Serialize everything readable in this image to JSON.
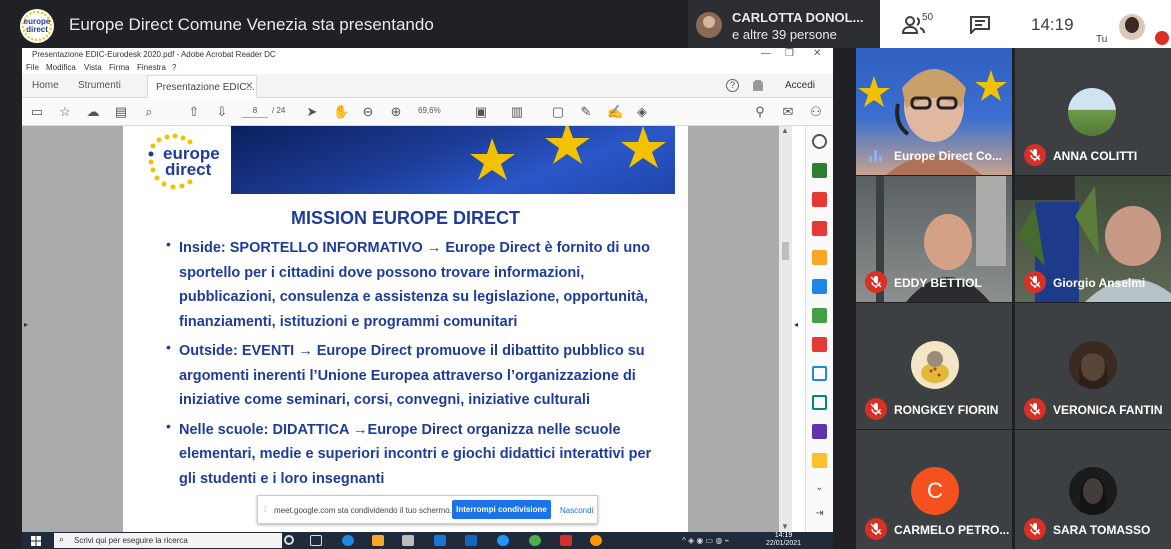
{
  "meet": {
    "title": "Europe Direct Comune Venezia sta presentando",
    "logo_line1": "europe",
    "logo_line2": "direct",
    "presenter_name": "CARLOTTA DONOL...",
    "presenter_sub": "e altre 39 persone",
    "people_count": "50",
    "time": "14:19",
    "self_label": "Tu"
  },
  "acrobat": {
    "window_title": "Presentazione EDIC-Eurodesk 2020.pdf - Adobe Acrobat Reader DC",
    "menu": [
      "File",
      "Modifica",
      "Vista",
      "Firma",
      "Finestra",
      "?"
    ],
    "tabs": [
      "Home",
      "Strumenti"
    ],
    "active_tab": "Presentazione EDIC...",
    "signin": "Accedi",
    "page_current": "8",
    "page_total": "/ 24",
    "zoom": "69,6%"
  },
  "document": {
    "logo_line1": "europe",
    "logo_line2": "direct",
    "heading": "MISSION EUROPE DIRECT",
    "bullets": [
      "Inside:  SPORTELLO INFORMATIVO → Europe Direct è fornito di uno sportello per i cittadini  dove possono trovare informazioni, pubblicazioni, consulenza e assistenza su legislazione, opportunità, finanziamenti, istituzioni e programmi comunitari",
      "Outside: EVENTI → Europe Direct promuove il dibattito pubblico su argomenti inerenti l’Unione Europea attraverso l’organizzazione di iniziative come seminari, corsi, convegni, iniziative culturali",
      "Nelle scuole: DIDATTICA  →Europe Direct organizza nelle scuole elementari, medie e superiori incontri e giochi didattici interattivi per gli studenti e i loro insegnanti"
    ]
  },
  "share_notice": {
    "message": "meet.google.com sta condividendo il tuo schermo.",
    "stop_label": "Interrompi condivisione",
    "hide_label": "Nascondi"
  },
  "taskbar": {
    "search_placeholder": "Scrivi qui per eseguire la ricerca",
    "time": "14:19",
    "date": "22/01/2021"
  },
  "participants": [
    {
      "name": "Europe Direct Co...",
      "speaking": true
    },
    {
      "name": "ANNA COLITTI",
      "muted": true
    },
    {
      "name": "EDDY BETTIOL",
      "muted": true
    },
    {
      "name": "Giorgio Anselmi",
      "muted": true
    },
    {
      "name": "RONGKEY FIORIN",
      "muted": true
    },
    {
      "name": "VERONICA FANTIN",
      "muted": true
    },
    {
      "name": "CARMELO PETRO...",
      "muted": true,
      "initial": "C"
    },
    {
      "name": "SARA TOMASSO",
      "muted": true
    }
  ],
  "colors": {
    "meet_bg": "#202124",
    "tile_bg": "#3c4043",
    "mute_red": "#d93025",
    "doc_blue": "#1f3c99",
    "google_blue": "#1a73e8"
  }
}
